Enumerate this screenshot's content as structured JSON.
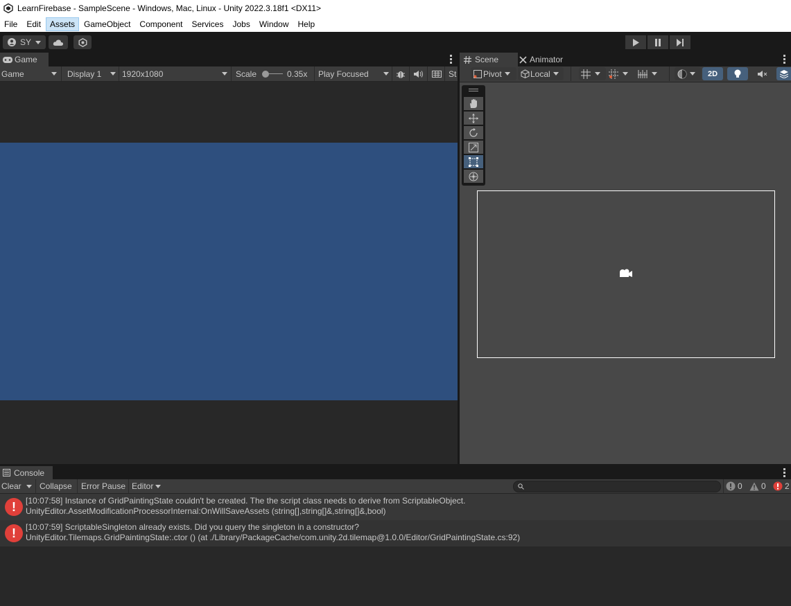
{
  "window": {
    "title": "LearnFirebase - SampleScene - Windows, Mac, Linux - Unity 2022.3.18f1 <DX11>"
  },
  "menu": [
    "File",
    "Edit",
    "Assets",
    "GameObject",
    "Component",
    "Services",
    "Jobs",
    "Window",
    "Help"
  ],
  "toolbar": {
    "account_label": "SY"
  },
  "game": {
    "tab_label": "Game",
    "mode_label": "Game",
    "display_label": "Display 1",
    "resolution_label": "1920x1080",
    "scale_label": "Scale",
    "scale_value": "0.35x",
    "play_focus_label": "Play Focused",
    "stats_label": "St",
    "background_color": "#2e4f7e"
  },
  "scene": {
    "tab_label": "Scene",
    "animator_tab_label": "Animator",
    "pivot_label": "Pivot",
    "local_label": "Local",
    "mode_2d_label": "2D"
  },
  "console": {
    "tab_label": "Console",
    "clear_label": "Clear",
    "collapse_label": "Collapse",
    "error_pause_label": "Error Pause",
    "editor_label": "Editor",
    "info_count": "0",
    "warning_count": "0",
    "error_count": "2",
    "logs": [
      {
        "line1": "[10:07:58] Instance of GridPaintingState couldn't be created. The the script class needs to derive from ScriptableObject.",
        "line2": "UnityEditor.AssetModificationProcessorInternal:OnWillSaveAssets (string[],string[]&,string[]&,bool)"
      },
      {
        "line1": "[10:07:59] ScriptableSingleton already exists. Did you query the singleton in a constructor?",
        "line2": "UnityEditor.Tilemaps.GridPaintingState:.ctor () (at ./Library/PackageCache/com.unity.2d.tilemap@1.0.0/Editor/GridPaintingState.cs:92)"
      }
    ]
  }
}
